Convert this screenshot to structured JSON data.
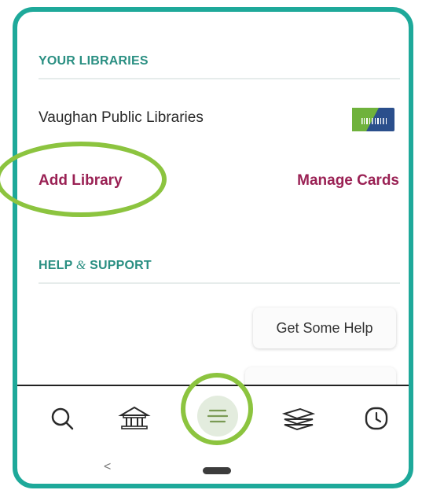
{
  "libraries": {
    "title": "YOUR LIBRARIES",
    "items": [
      {
        "name": "Vaughan Public Libraries"
      }
    ],
    "add_label": "Add Library",
    "manage_label": "Manage Cards"
  },
  "help": {
    "title_part1": "HELP",
    "title_amp": "&",
    "title_part2": "SUPPORT",
    "get_help_label": "Get Some Help"
  },
  "nav": {
    "items": [
      {
        "icon": "search-icon"
      },
      {
        "icon": "library-icon"
      },
      {
        "icon": "menu-icon",
        "selected": true
      },
      {
        "icon": "shelf-icon"
      },
      {
        "icon": "activity-clock-icon"
      }
    ]
  },
  "colors": {
    "accent_teal": "#1ea99a",
    "section_teal": "#2a8f82",
    "link_maroon": "#9a2154",
    "highlight_green": "#8cc43f"
  }
}
